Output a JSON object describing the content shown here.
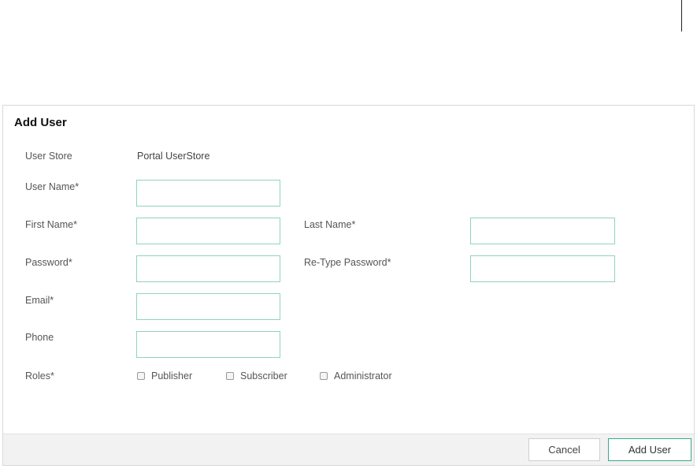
{
  "dialog": {
    "title": "Add User"
  },
  "form": {
    "user_store_label": "User Store",
    "user_store_value": "Portal UserStore",
    "username_label": "User Name*",
    "username_value": "",
    "first_name_label": "First Name*",
    "first_name_value": "",
    "last_name_label": "Last Name*",
    "last_name_value": "",
    "password_label": "Password*",
    "password_value": "",
    "retype_password_label": "Re-Type Password*",
    "retype_password_value": "",
    "email_label": "Email*",
    "email_value": "",
    "phone_label": "Phone",
    "phone_value": "",
    "roles_label": "Roles*",
    "roles": [
      {
        "label": "Publisher",
        "checked": false
      },
      {
        "label": "Subscriber",
        "checked": false
      },
      {
        "label": "Administrator",
        "checked": false
      }
    ]
  },
  "footer": {
    "cancel_label": "Cancel",
    "add_user_label": "Add User"
  },
  "colors": {
    "field_border": "#8fd3c0",
    "primary_button_border": "#3aa88c"
  }
}
